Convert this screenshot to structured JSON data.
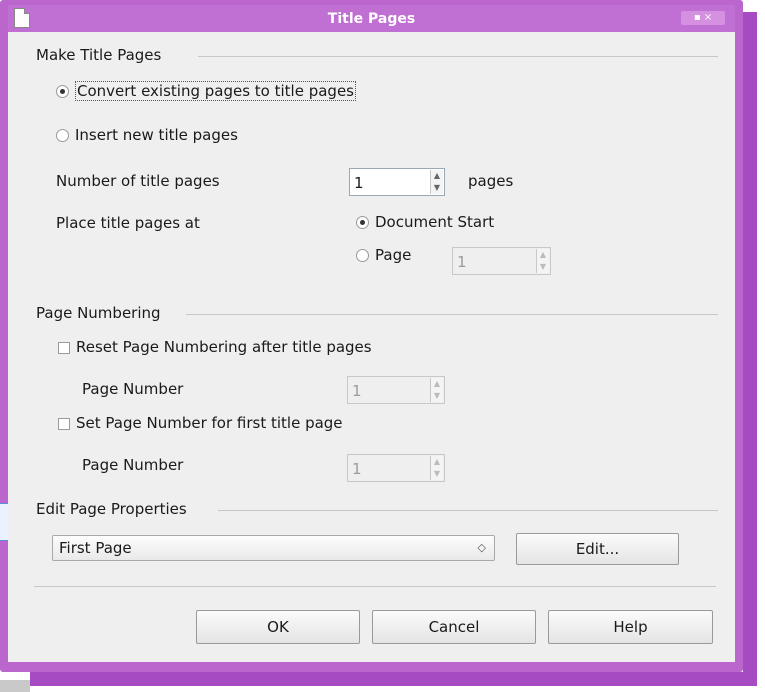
{
  "window": {
    "title": "Title Pages",
    "controls": "▪ ×"
  },
  "make_title_pages": {
    "heading": "Make Title Pages",
    "convert_option": "Convert existing pages to title pages",
    "insert_option": "Insert new title pages",
    "number_label": "Number of title pages",
    "number_value": "1",
    "number_unit": "pages",
    "place_label": "Place title pages at",
    "document_start_option": "Document Start",
    "page_option": "Page",
    "page_value": "1"
  },
  "page_numbering": {
    "heading": "Page Numbering",
    "reset_option": "Reset Page Numbering after title pages",
    "reset_page_number_label": "Page Number",
    "reset_page_number_value": "1",
    "set_option": "Set Page Number for first title page",
    "set_page_number_label": "Page Number",
    "set_page_number_value": "1"
  },
  "edit_properties": {
    "heading": "Edit Page Properties",
    "style_selected": "First Page",
    "edit_button": "Edit..."
  },
  "buttons": {
    "ok": "OK",
    "cancel": "Cancel",
    "help": "Help"
  }
}
